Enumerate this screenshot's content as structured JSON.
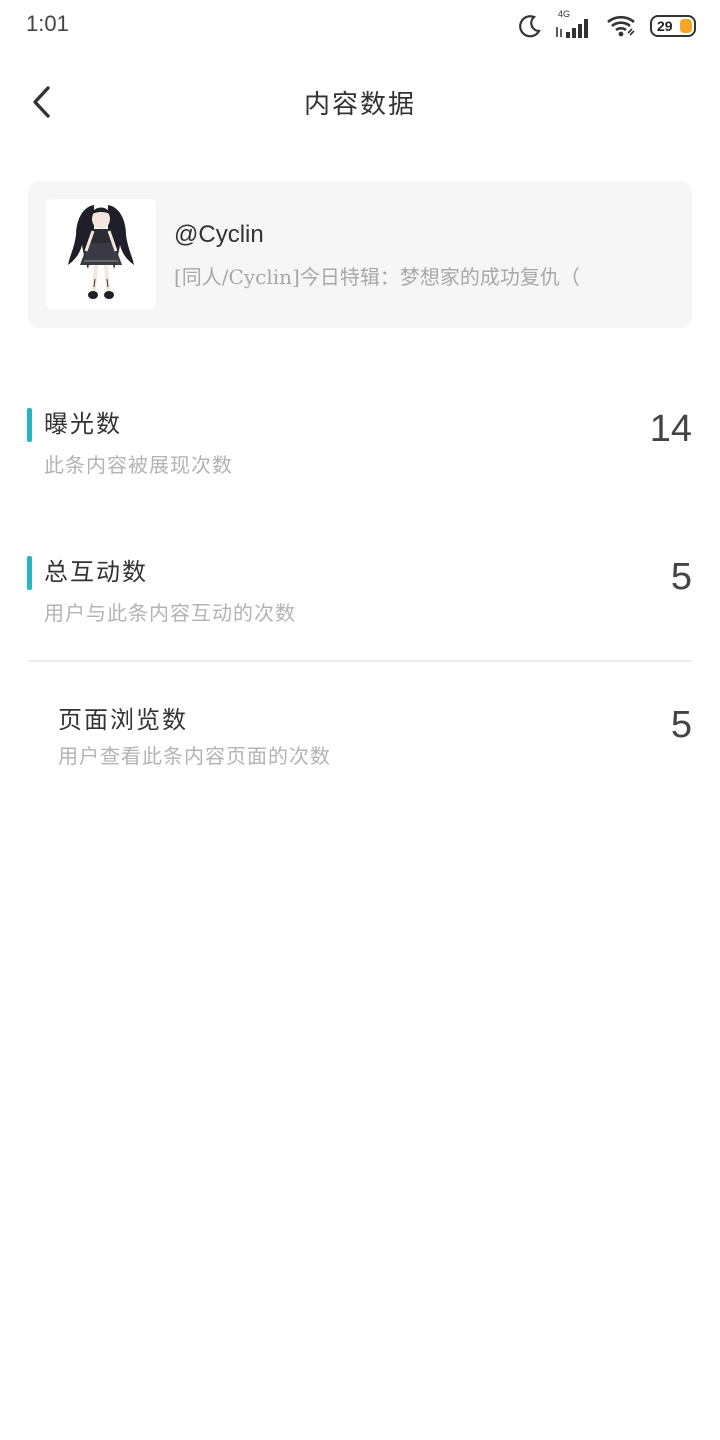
{
  "status_bar": {
    "time": "1:01",
    "network_label": "4G",
    "battery_level": "29",
    "icons": [
      "moon-icon",
      "signal-icon",
      "wifi-icon",
      "battery-icon"
    ]
  },
  "header": {
    "title": "内容数据",
    "back_icon": "chevron-left-icon"
  },
  "content_card": {
    "author": "@Cyclin",
    "excerpt": "[同人/Cyclin]今日特辑：梦想家的成功复仇（"
  },
  "metrics": [
    {
      "title": "曝光数",
      "description": "此条内容被展现次数",
      "value": "14",
      "highlighted": true
    },
    {
      "title": "总互动数",
      "description": "用户与此条内容互动的次数",
      "value": "5",
      "highlighted": true
    },
    {
      "title": "页面浏览数",
      "description": "用户查看此条内容页面的次数",
      "value": "5",
      "highlighted": false
    }
  ],
  "colors": {
    "accent": "#27b5c6",
    "battery": "#f5a623",
    "card_background": "#f6f6f6"
  }
}
